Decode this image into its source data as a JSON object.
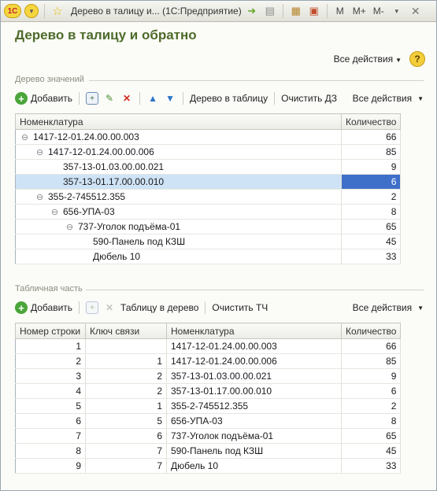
{
  "window": {
    "title": "Дерево в талицу и...  (1С:Предприятие)",
    "logo": "1С",
    "memory_buttons": [
      "M",
      "M+",
      "M-"
    ]
  },
  "form": {
    "title": "Дерево в талицу и обратно",
    "all_actions": "Все действия",
    "help": "?"
  },
  "tree_group": {
    "label": "Дерево значений",
    "toolbar": {
      "add": "Добавить",
      "to_table": "Дерево в таблицу",
      "clear": "Очистить ДЗ",
      "all_actions": "Все действия"
    },
    "columns": {
      "nomenclature": "Номенклатура",
      "quantity": "Количество"
    },
    "rows": [
      {
        "name": "1417-12-01.24.00.00.003",
        "qty": "66",
        "level": 0,
        "expanded": true
      },
      {
        "name": "1417-12-01.24.00.00.006",
        "qty": "85",
        "level": 1,
        "expanded": true
      },
      {
        "name": "357-13-01.03.00.00.021",
        "qty": "9",
        "level": 2,
        "expanded": false
      },
      {
        "name": "357-13-01.17.00.00.010",
        "qty": "6",
        "level": 2,
        "expanded": false,
        "selected": true
      },
      {
        "name": "355-2-745512.355",
        "qty": "2",
        "level": 1,
        "expanded": true
      },
      {
        "name": "656-УПА-03",
        "qty": "8",
        "level": 2,
        "expanded": true
      },
      {
        "name": "737-Уголок подъёма-01",
        "qty": "65",
        "level": 3,
        "expanded": true
      },
      {
        "name": "590-Панель под КЗШ",
        "qty": "45",
        "level": 4,
        "expanded": false
      },
      {
        "name": "Дюбель 10",
        "qty": "33",
        "level": 4,
        "expanded": false
      }
    ]
  },
  "table_group": {
    "label": "Табличная часть",
    "toolbar": {
      "add": "Добавить",
      "to_tree": "Таблицу в дерево",
      "clear": "Очистить ТЧ",
      "all_actions": "Все действия"
    },
    "columns": {
      "row_number": "Номер строки",
      "link_key": "Ключ связи",
      "nomenclature": "Номенклатура",
      "quantity": "Количество"
    },
    "rows": [
      {
        "row": "1",
        "key": "",
        "name": "1417-12-01.24.00.00.003",
        "qty": "66"
      },
      {
        "row": "2",
        "key": "1",
        "name": "1417-12-01.24.00.00.006",
        "qty": "85"
      },
      {
        "row": "3",
        "key": "2",
        "name": "357-13-01.03.00.00.021",
        "qty": "9"
      },
      {
        "row": "4",
        "key": "2",
        "name": "357-13-01.17.00.00.010",
        "qty": "6"
      },
      {
        "row": "5",
        "key": "1",
        "name": "355-2-745512.355",
        "qty": "2"
      },
      {
        "row": "6",
        "key": "5",
        "name": "656-УПА-03",
        "qty": "8"
      },
      {
        "row": "7",
        "key": "6",
        "name": "737-Уголок подъёма-01",
        "qty": "65"
      },
      {
        "row": "8",
        "key": "7",
        "name": "590-Панель под КЗШ",
        "qty": "45"
      },
      {
        "row": "9",
        "key": "7",
        "name": "Дюбель 10",
        "qty": "33"
      }
    ]
  },
  "colors": {
    "title_green": "#4d6b2a",
    "selection_row": "#cfe3f6",
    "selection_cell": "#3e6fc9"
  }
}
